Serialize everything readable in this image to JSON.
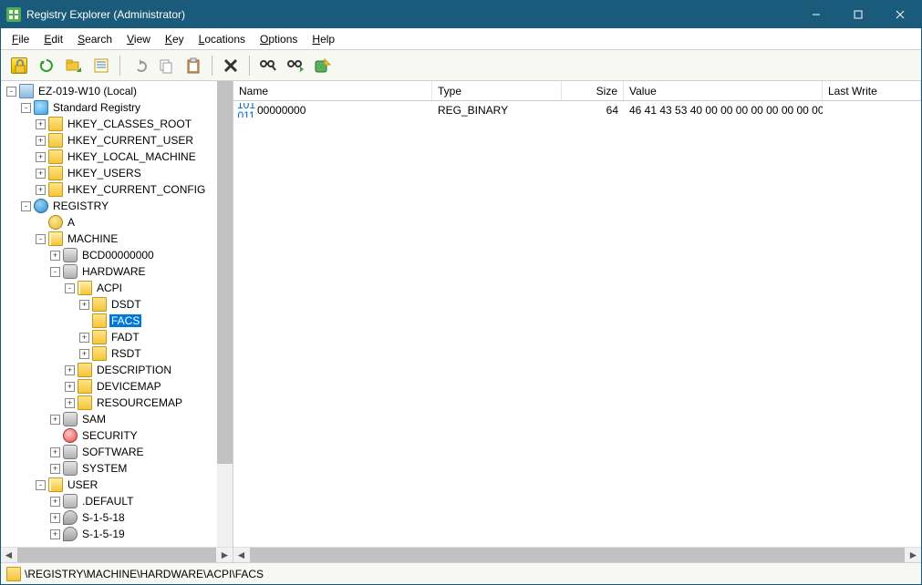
{
  "titlebar": {
    "title": "Registry Explorer (Administrator)"
  },
  "menu": {
    "file": "File",
    "edit": "Edit",
    "search": "Search",
    "view": "View",
    "key": "Key",
    "locations": "Locations",
    "options": "Options",
    "help": "Help"
  },
  "toolbar": {
    "lock": "lock",
    "refresh": "refresh",
    "browse": "browse",
    "notes": "notes",
    "undo": "undo",
    "copy": "copy",
    "paste": "paste",
    "delete": "delete",
    "find": "find",
    "findnext": "find-next",
    "export": "export"
  },
  "list": {
    "columns": {
      "name": "Name",
      "type": "Type",
      "size": "Size",
      "value": "Value",
      "lastwrite": "Last Write"
    },
    "widths": {
      "name": 218,
      "type": 142,
      "size": 68,
      "value": 218,
      "lastwrite": 78
    },
    "rows": [
      {
        "name": "00000000",
        "type": "REG_BINARY",
        "size": "64",
        "value": "46 41 43 53 40 00 00 00 00 00 00 00 00 00 00 ...",
        "lastwrite": ""
      }
    ]
  },
  "status": {
    "path": "\\REGISTRY\\MACHINE\\HARDWARE\\ACPI\\FACS"
  },
  "tree": [
    {
      "indent": 0,
      "exp": "-",
      "icon": "ico-computer",
      "label": "EZ-019-W10 (Local)"
    },
    {
      "indent": 1,
      "exp": "-",
      "icon": "ico-reg",
      "label": "Standard Registry"
    },
    {
      "indent": 2,
      "exp": "+",
      "icon": "ico-folder",
      "label": "HKEY_CLASSES_ROOT"
    },
    {
      "indent": 2,
      "exp": "+",
      "icon": "ico-folder",
      "label": "HKEY_CURRENT_USER"
    },
    {
      "indent": 2,
      "exp": "+",
      "icon": "ico-folder",
      "label": "HKEY_LOCAL_MACHINE"
    },
    {
      "indent": 2,
      "exp": "+",
      "icon": "ico-folder",
      "label": "HKEY_USERS"
    },
    {
      "indent": 2,
      "exp": "+",
      "icon": "ico-folder",
      "label": "HKEY_CURRENT_CONFIG"
    },
    {
      "indent": 1,
      "exp": "-",
      "icon": "ico-hive",
      "label": "REGISTRY"
    },
    {
      "indent": 2,
      "exp": "",
      "icon": "ico-key",
      "label": "A"
    },
    {
      "indent": 2,
      "exp": "-",
      "icon": "ico-folder-open",
      "label": "MACHINE"
    },
    {
      "indent": 3,
      "exp": "+",
      "icon": "ico-db",
      "label": "BCD00000000"
    },
    {
      "indent": 3,
      "exp": "-",
      "icon": "ico-db",
      "label": "HARDWARE"
    },
    {
      "indent": 4,
      "exp": "-",
      "icon": "ico-folder-open",
      "label": "ACPI"
    },
    {
      "indent": 5,
      "exp": "+",
      "icon": "ico-folder",
      "label": "DSDT"
    },
    {
      "indent": 5,
      "exp": "",
      "icon": "ico-folder",
      "label": "FACS",
      "selected": true
    },
    {
      "indent": 5,
      "exp": "+",
      "icon": "ico-folder",
      "label": "FADT"
    },
    {
      "indent": 5,
      "exp": "+",
      "icon": "ico-folder",
      "label": "RSDT"
    },
    {
      "indent": 4,
      "exp": "+",
      "icon": "ico-folder",
      "label": "DESCRIPTION"
    },
    {
      "indent": 4,
      "exp": "+",
      "icon": "ico-folder",
      "label": "DEVICEMAP"
    },
    {
      "indent": 4,
      "exp": "+",
      "icon": "ico-folder",
      "label": "RESOURCEMAP"
    },
    {
      "indent": 3,
      "exp": "+",
      "icon": "ico-db",
      "label": "SAM"
    },
    {
      "indent": 3,
      "exp": "",
      "icon": "ico-sec",
      "label": "SECURITY"
    },
    {
      "indent": 3,
      "exp": "+",
      "icon": "ico-db",
      "label": "SOFTWARE"
    },
    {
      "indent": 3,
      "exp": "+",
      "icon": "ico-db",
      "label": "SYSTEM"
    },
    {
      "indent": 2,
      "exp": "-",
      "icon": "ico-folder-open",
      "label": "USER"
    },
    {
      "indent": 3,
      "exp": "+",
      "icon": "ico-db",
      "label": ".DEFAULT"
    },
    {
      "indent": 3,
      "exp": "+",
      "icon": "ico-sid",
      "label": "S-1-5-18"
    },
    {
      "indent": 3,
      "exp": "+",
      "icon": "ico-sid",
      "label": "S-1-5-19"
    }
  ]
}
